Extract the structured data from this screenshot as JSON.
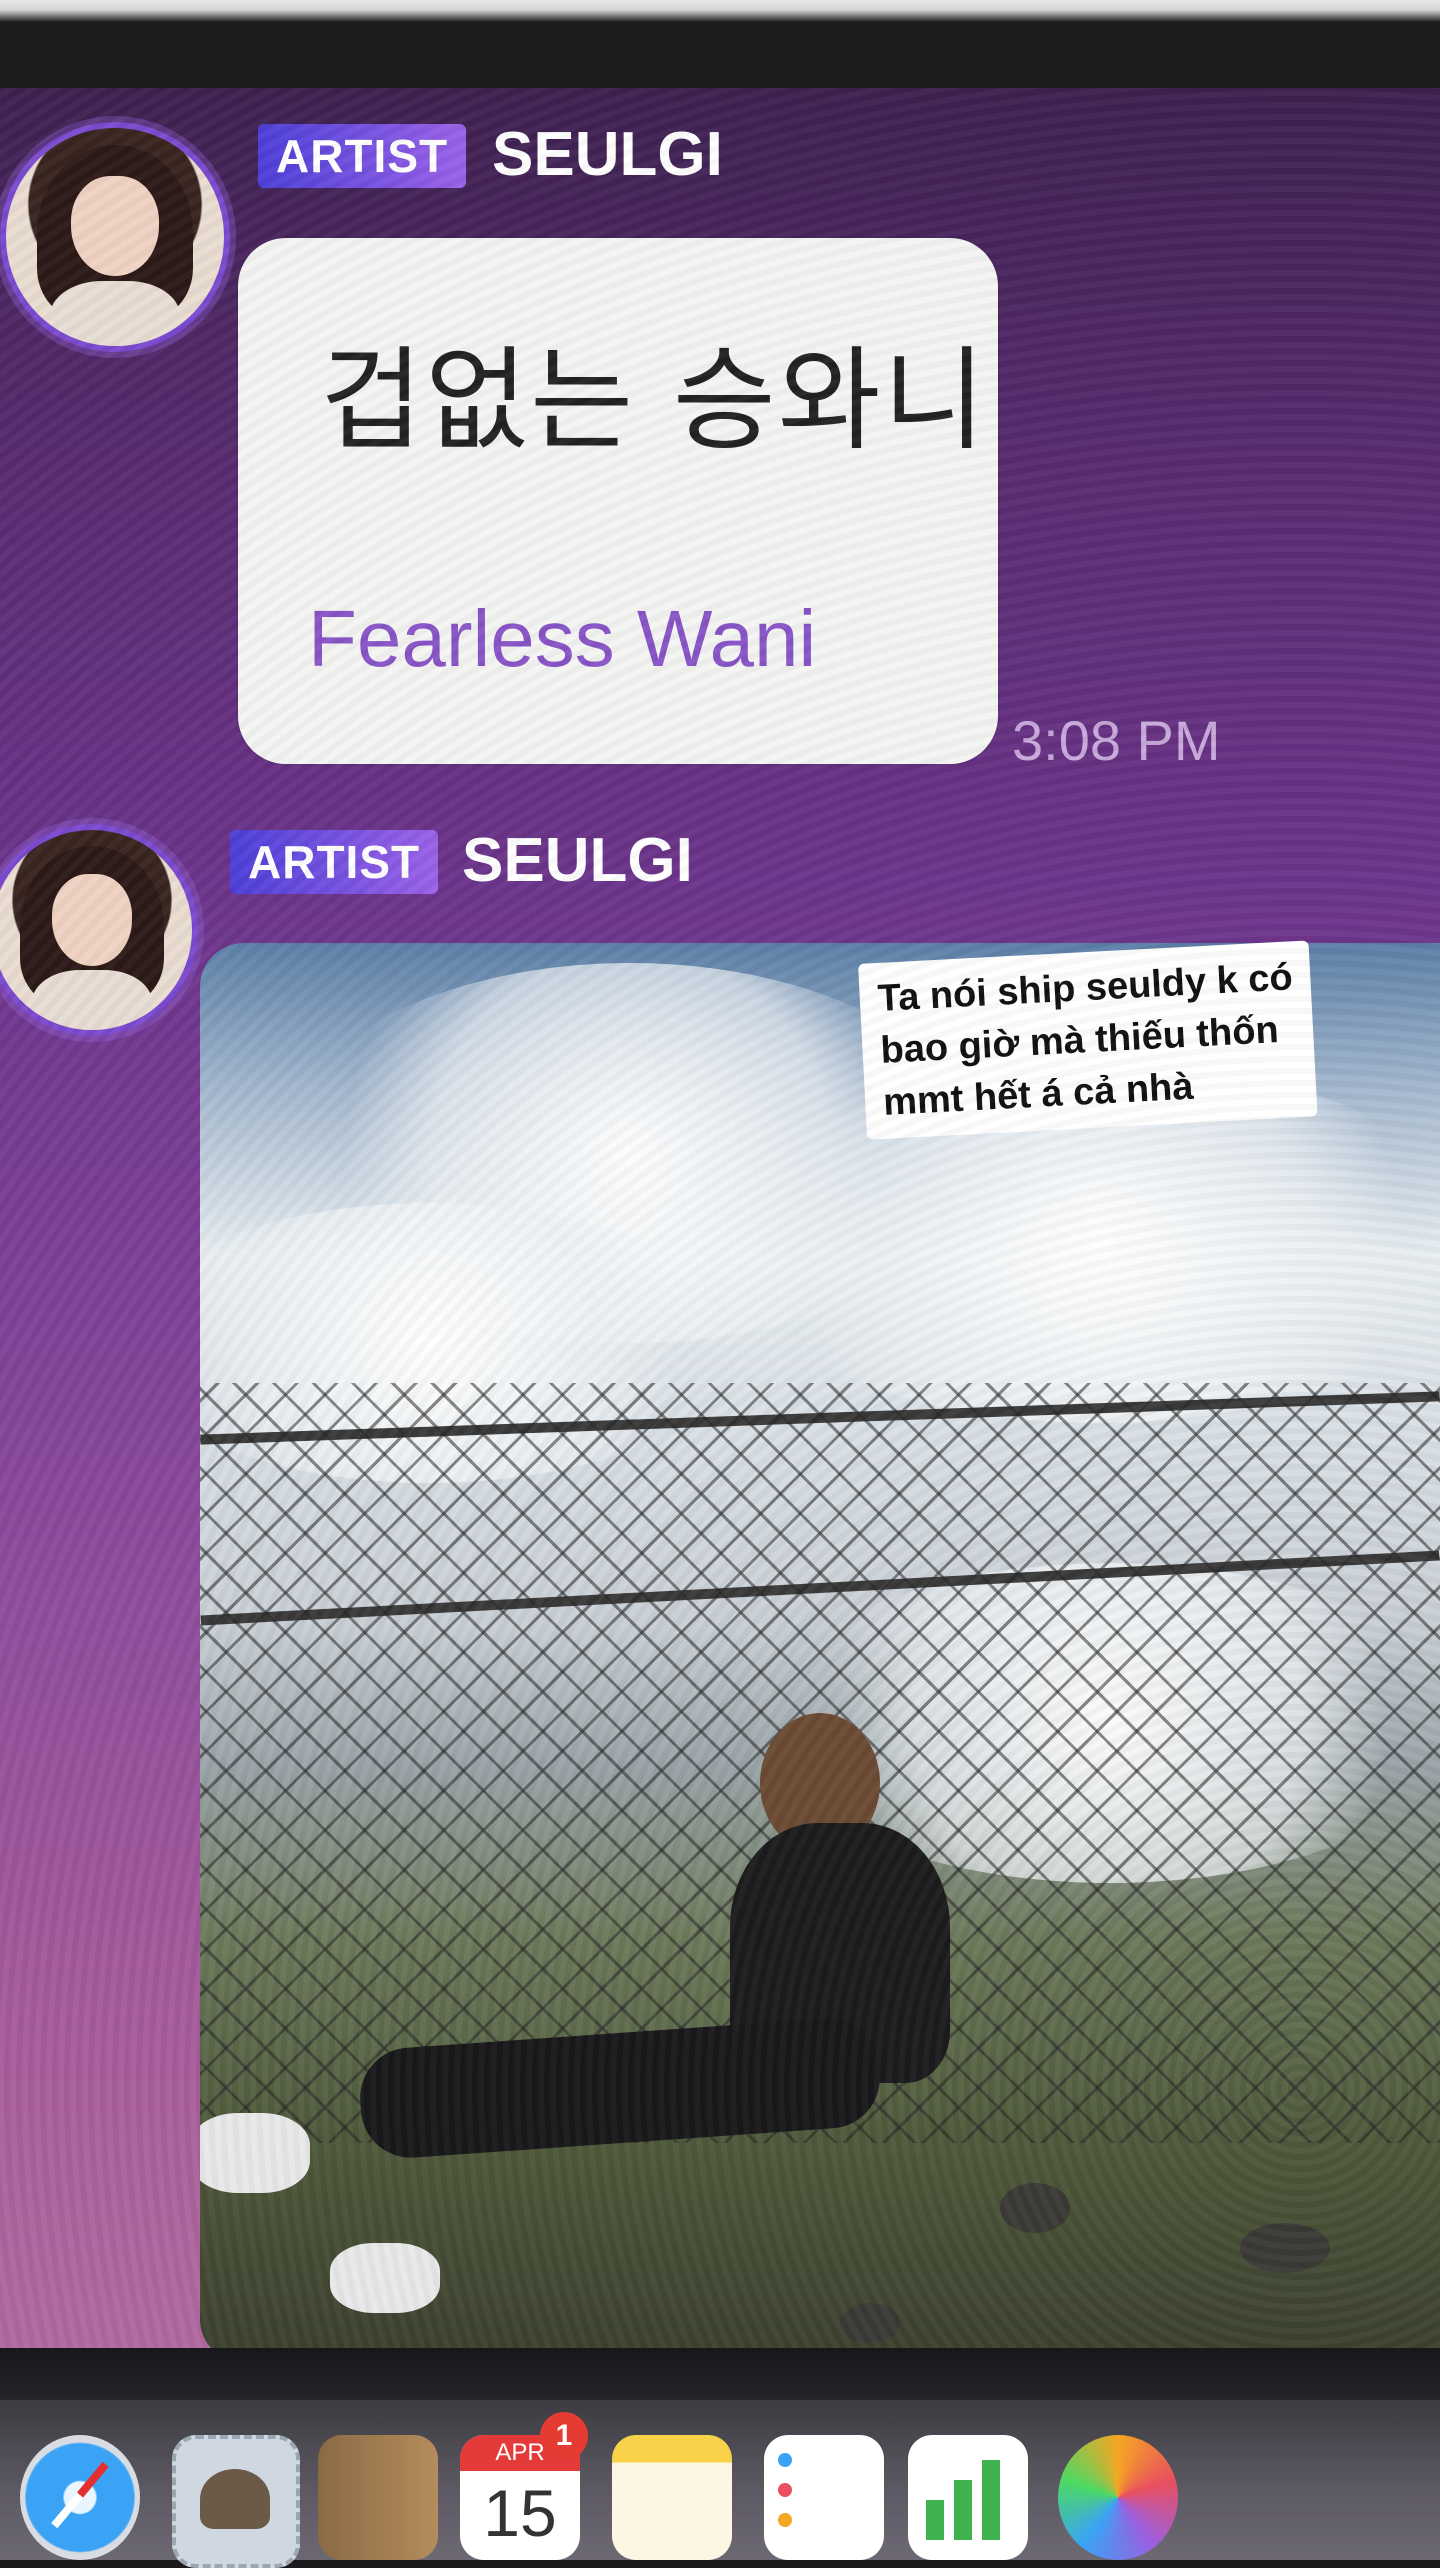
{
  "messages": [
    {
      "badge": "ARTIST",
      "sender": "SEULGI",
      "text": "겁없는 승와니",
      "translation": "Fearless Wani",
      "time": "3:08 PM"
    },
    {
      "badge": "ARTIST",
      "sender": "SEULGI",
      "type": "photo"
    }
  ],
  "overlay_caption": {
    "lines": [
      "Ta nói ship seuldy k có",
      "bao giờ mà thiếu thốn",
      "mmt hết á cả nhà"
    ]
  },
  "dock": {
    "calendar_month": "APR",
    "calendar_day": "15",
    "calendar_badge": "1",
    "icons": [
      "safari-icon",
      "preview-icon",
      "books-icon",
      "calendar-icon",
      "notes-icon",
      "reminders-icon",
      "numbers-icon",
      "photos-icon"
    ]
  },
  "colors": {
    "badge_start": "#4c3fd8",
    "badge_end": "#9b62e8",
    "translation": "#8854c7",
    "timestamp": "#c7a9da",
    "avatar_ring": "#7c4ad0"
  }
}
